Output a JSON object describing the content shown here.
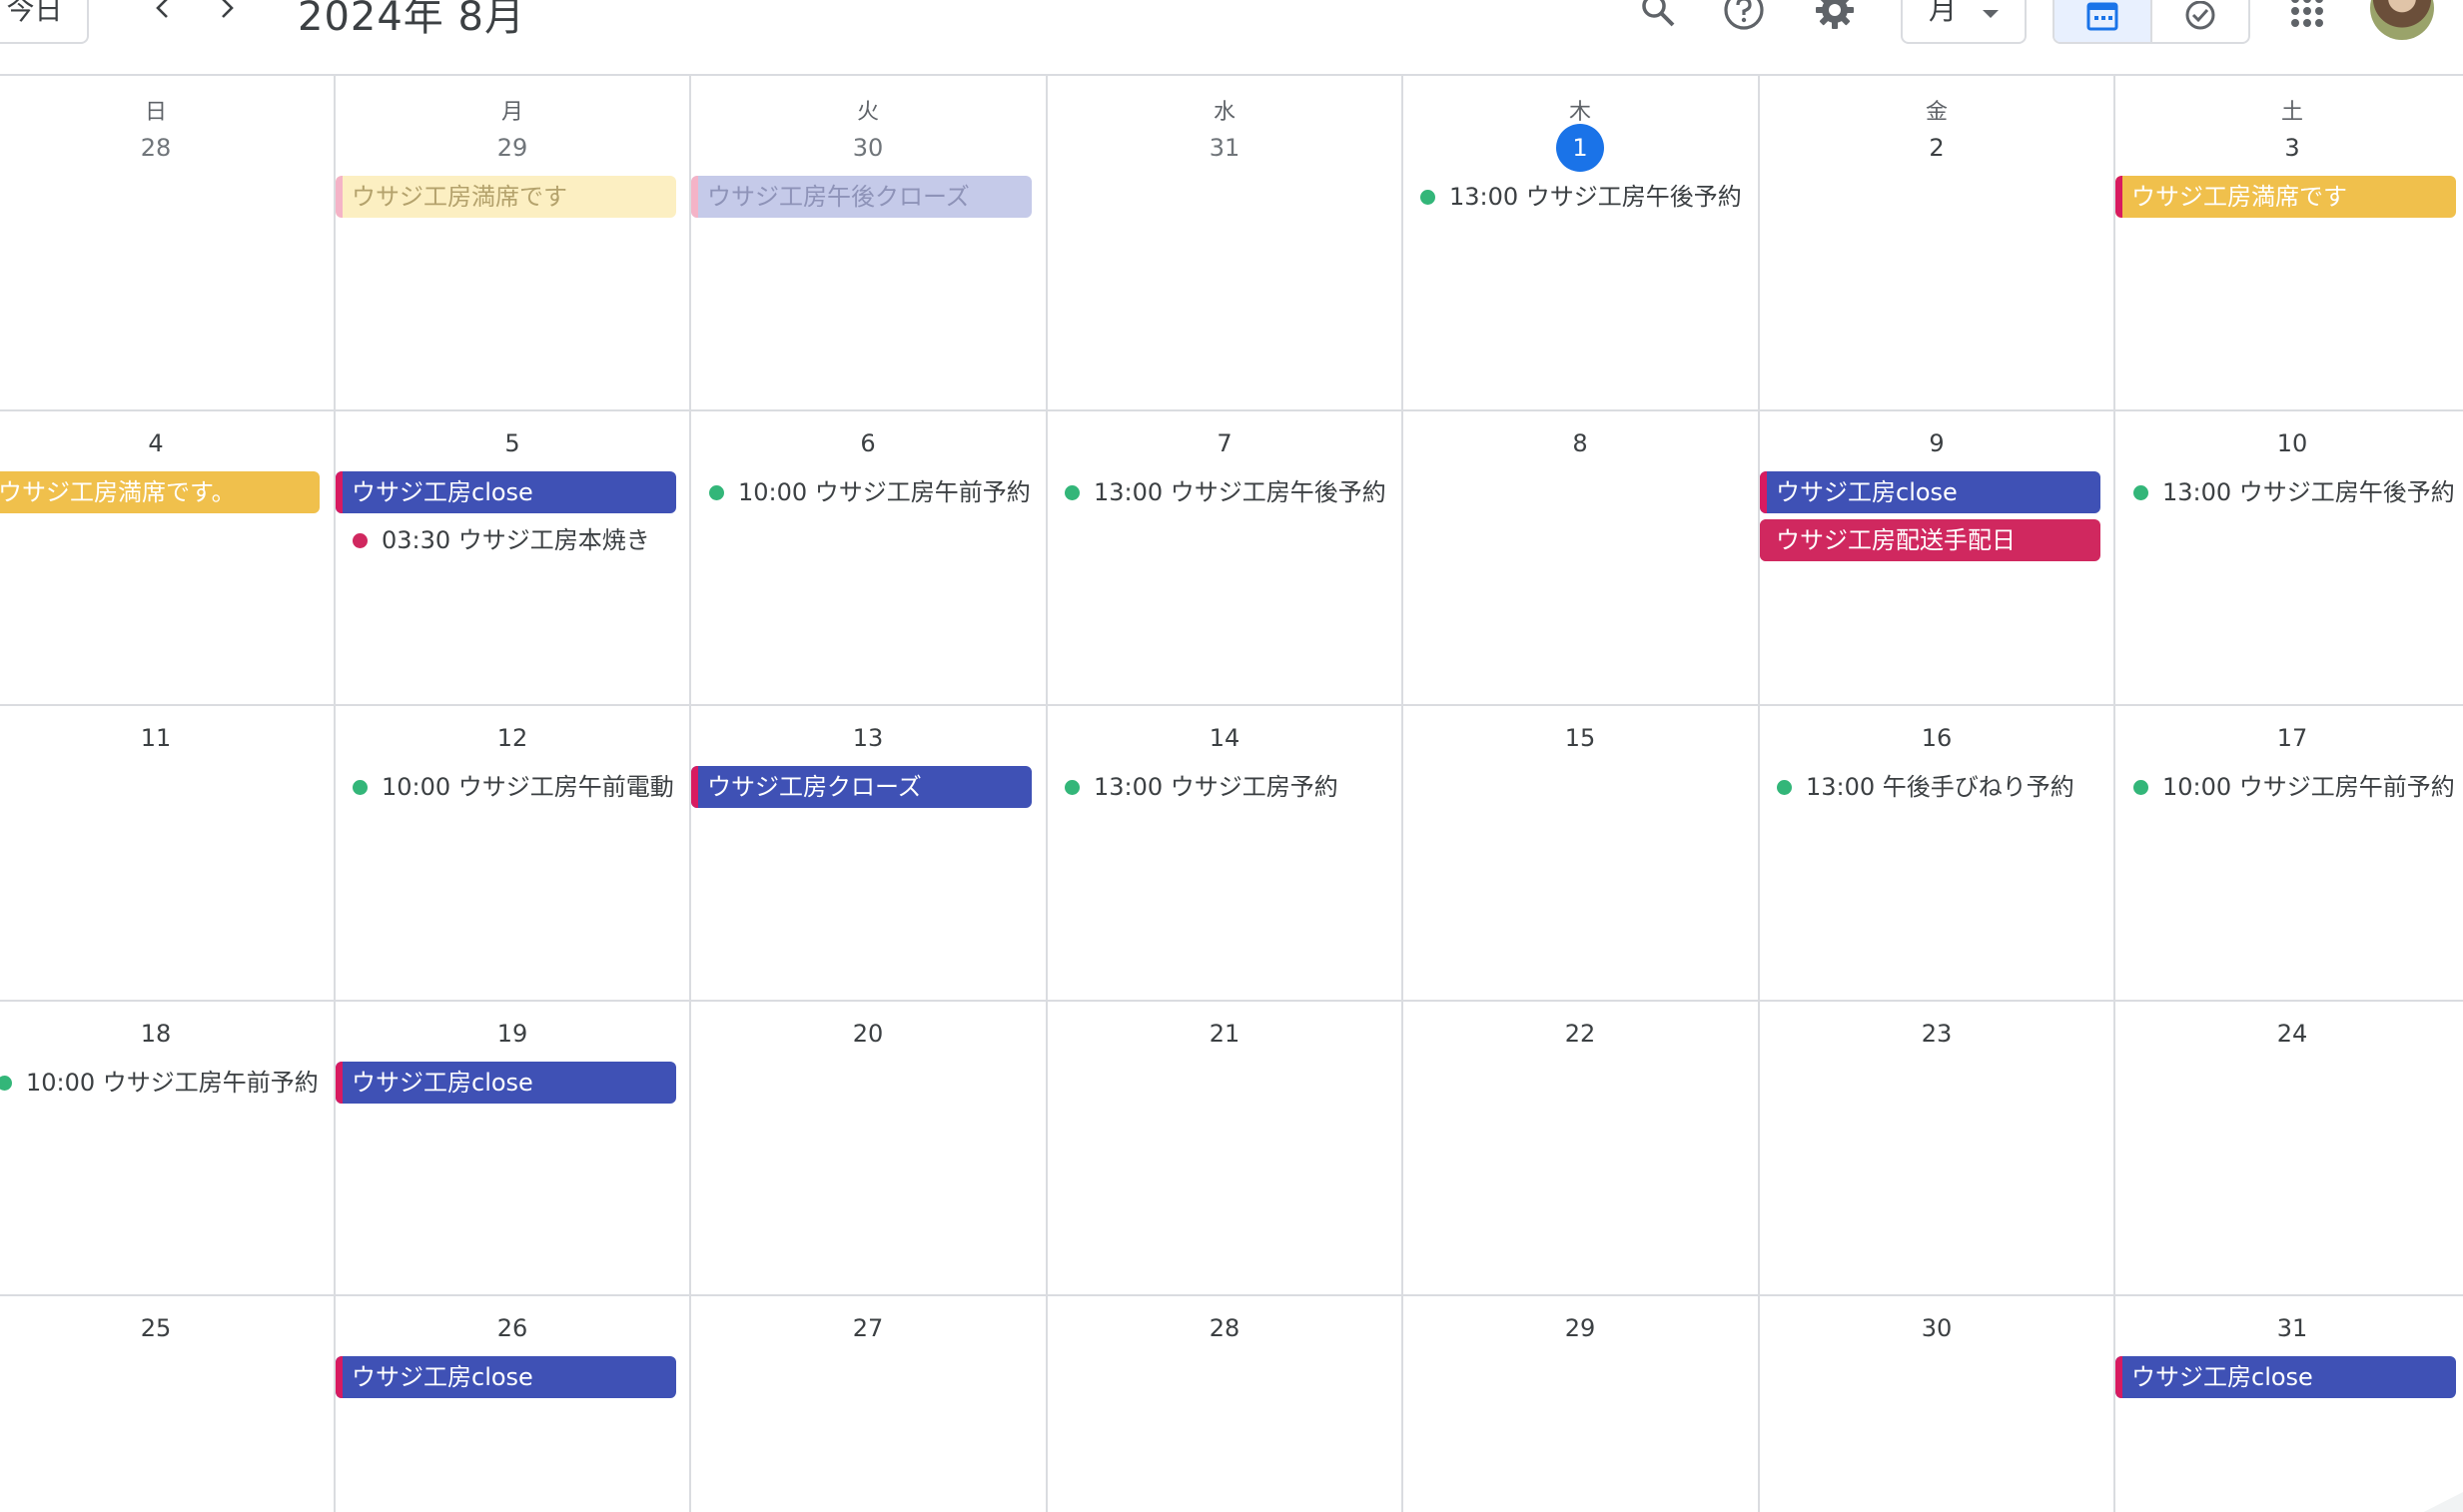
{
  "header": {
    "today_label": "今日",
    "title": "2024年 8月",
    "view_label": "月",
    "icons": [
      "chevron-left-icon",
      "chevron-right-icon",
      "search-icon",
      "help-icon",
      "gear-icon",
      "calendar-icon",
      "task-check-icon",
      "apps-grid-icon"
    ]
  },
  "weekdays": [
    "日",
    "月",
    "火",
    "水",
    "木",
    "金",
    "土"
  ],
  "weeks": [
    {
      "days": [
        "28",
        "29",
        "30",
        "31",
        "1",
        "2",
        "3"
      ]
    },
    {
      "days": [
        "4",
        "5",
        "6",
        "7",
        "8",
        "9",
        "10"
      ]
    },
    {
      "days": [
        "11",
        "12",
        "13",
        "14",
        "15",
        "16",
        "17"
      ]
    },
    {
      "days": [
        "18",
        "19",
        "20",
        "21",
        "22",
        "23",
        "24"
      ]
    },
    {
      "days": [
        "25",
        "26",
        "27",
        "28",
        "29",
        "30",
        "31"
      ]
    }
  ],
  "events": {
    "w0_mon": "ウサジ工房満席です",
    "w0_tue": "ウサジ工房午後クローズ",
    "w0_thu": "13:00 ウサジ工房午後予約",
    "w0_sat": "ウサジ工房満席です",
    "w1_sun": "ウサジ工房満席です。",
    "w1_mon_chip": "ウサジ工房close",
    "w1_mon_timed": "03:30 ウサジ工房本焼き",
    "w1_tue": "10:00 ウサジ工房午前予約",
    "w1_wed": "13:00 ウサジ工房午後予約",
    "w1_fri_chip1": "ウサジ工房close",
    "w1_fri_chip2": "ウサジ工房配送手配日",
    "w1_sat": "13:00 ウサジ工房午後予約",
    "w2_mon": "10:00 ウサジ工房午前電動",
    "w2_tue": "ウサジ工房クローズ",
    "w2_wed": "13:00 ウサジ工房予約",
    "w2_fri": "13:00 午後手びねり予約",
    "w2_sat": "10:00 ウサジ工房午前予約",
    "w3_sun": "10:00 ウサジ工房午前予約",
    "w3_mon": "ウサジ工房close",
    "w4_mon": "ウサジ工房close",
    "w4_sat": "ウサジ工房close"
  },
  "colors": {
    "today": "#1a73e8",
    "blueberry": "#3f51b5",
    "banana": "#f0c04c",
    "beetroot": "#d0285f",
    "sage": "#33b679"
  }
}
